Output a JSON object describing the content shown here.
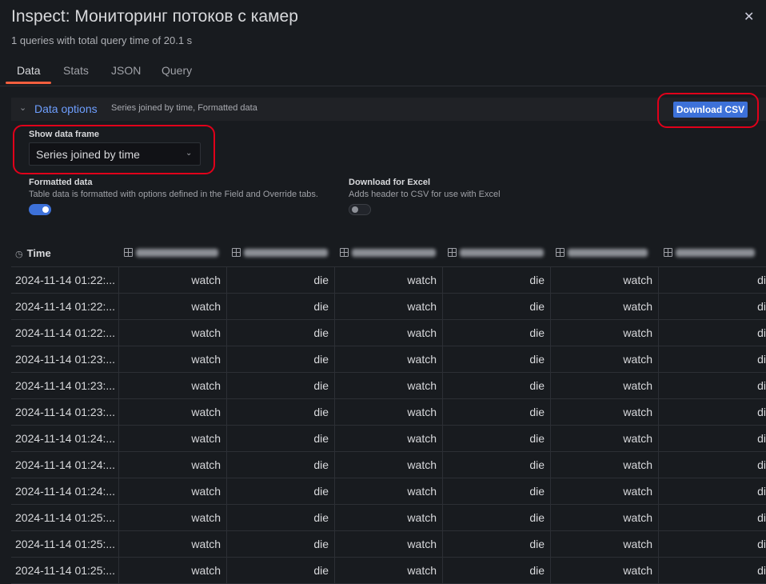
{
  "drawer": {
    "title": "Inspect: Мониторинг потоков с камер",
    "subtitle": "1 queries with total query time of 20.1 s",
    "close_icon": "close-icon"
  },
  "tabs": [
    {
      "label": "Data",
      "active": true
    },
    {
      "label": "Stats",
      "active": false
    },
    {
      "label": "JSON",
      "active": false
    },
    {
      "label": "Query",
      "active": false
    }
  ],
  "data_options": {
    "title": "Data options",
    "summary": "Series joined by time, Formatted data",
    "download_button": "Download CSV",
    "show_data_frame": {
      "label": "Show data frame",
      "value": "Series joined by time"
    },
    "formatted_data": {
      "label": "Formatted data",
      "description": "Table data is formatted with options defined in the Field and Override tabs.",
      "enabled": true
    },
    "download_for_excel": {
      "label": "Download for Excel",
      "description": "Adds header to CSV for use with Excel",
      "enabled": false
    }
  },
  "colors": {
    "accent": "#3d71d9",
    "tab_active_underline": "#f55f3e",
    "highlight_ring": "#e0001a",
    "background": "#181b1f"
  },
  "table": {
    "time_header": "Time",
    "rows": [
      {
        "time": "2024-11-14 01:22:...",
        "values": [
          "watch",
          "die",
          "watch",
          "die",
          "watch",
          "di"
        ]
      },
      {
        "time": "2024-11-14 01:22:...",
        "values": [
          "watch",
          "die",
          "watch",
          "die",
          "watch",
          "di"
        ]
      },
      {
        "time": "2024-11-14 01:22:...",
        "values": [
          "watch",
          "die",
          "watch",
          "die",
          "watch",
          "di"
        ]
      },
      {
        "time": "2024-11-14 01:23:...",
        "values": [
          "watch",
          "die",
          "watch",
          "die",
          "watch",
          "di"
        ]
      },
      {
        "time": "2024-11-14 01:23:...",
        "values": [
          "watch",
          "die",
          "watch",
          "die",
          "watch",
          "di"
        ]
      },
      {
        "time": "2024-11-14 01:23:...",
        "values": [
          "watch",
          "die",
          "watch",
          "die",
          "watch",
          "di"
        ]
      },
      {
        "time": "2024-11-14 01:24:...",
        "values": [
          "watch",
          "die",
          "watch",
          "die",
          "watch",
          "di"
        ]
      },
      {
        "time": "2024-11-14 01:24:...",
        "values": [
          "watch",
          "die",
          "watch",
          "die",
          "watch",
          "di"
        ]
      },
      {
        "time": "2024-11-14 01:24:...",
        "values": [
          "watch",
          "die",
          "watch",
          "die",
          "watch",
          "di"
        ]
      },
      {
        "time": "2024-11-14 01:25:...",
        "values": [
          "watch",
          "die",
          "watch",
          "die",
          "watch",
          "di"
        ]
      },
      {
        "time": "2024-11-14 01:25:...",
        "values": [
          "watch",
          "die",
          "watch",
          "die",
          "watch",
          "di"
        ]
      },
      {
        "time": "2024-11-14 01:25:...",
        "values": [
          "watch",
          "die",
          "watch",
          "die",
          "watch",
          "di"
        ]
      }
    ]
  }
}
